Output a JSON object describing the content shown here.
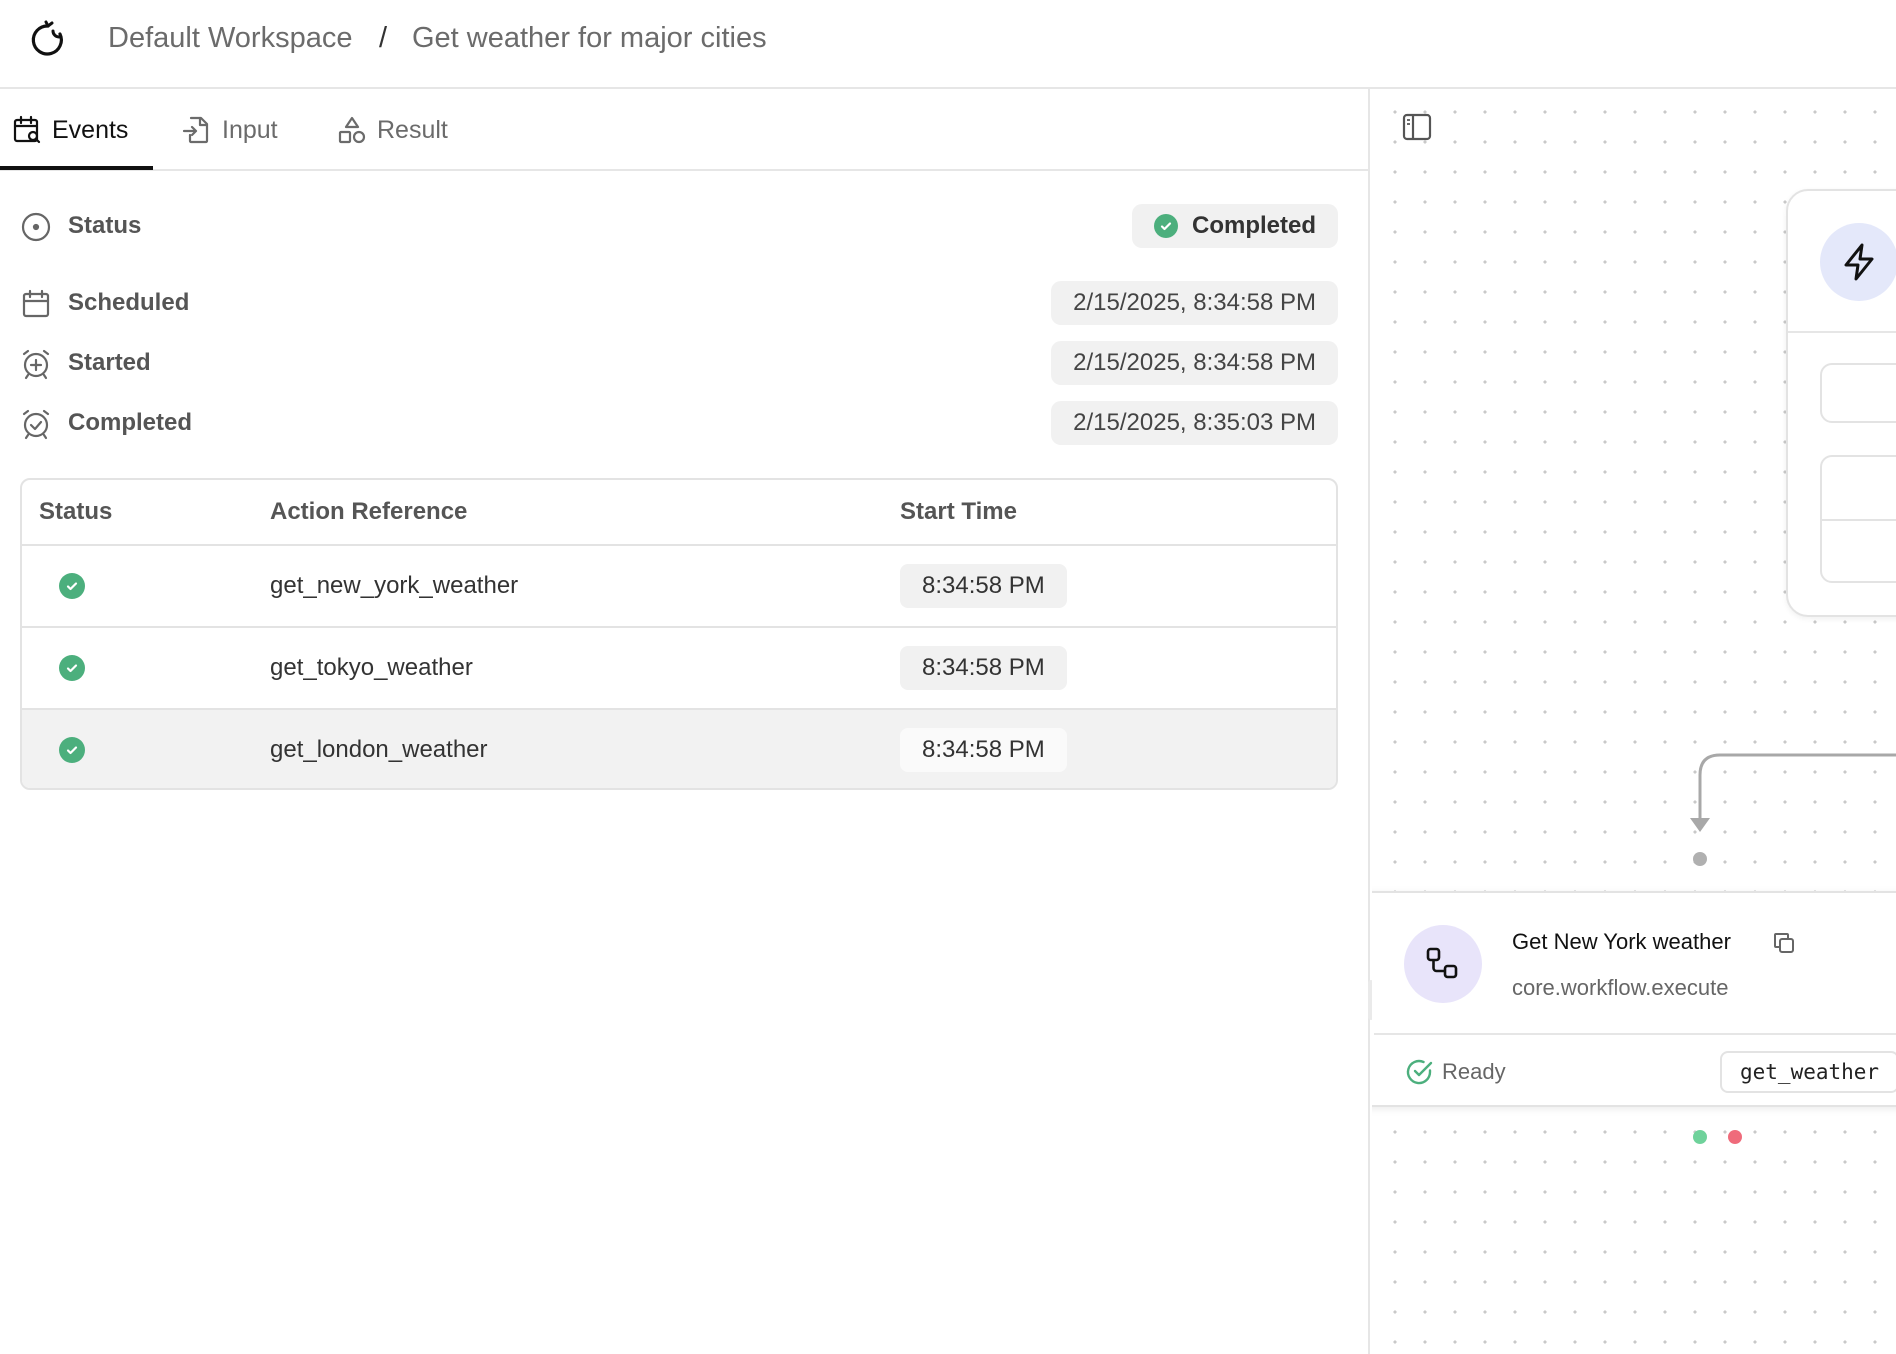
{
  "header": {
    "workspace": "Default Workspace",
    "separator": "/",
    "workflow_title": "Get weather for major cities"
  },
  "tabs": [
    {
      "label": "Events",
      "icon": "calendar-search-icon",
      "active": true
    },
    {
      "label": "Input",
      "icon": "file-import-icon",
      "active": false
    },
    {
      "label": "Result",
      "icon": "shapes-icon",
      "active": false
    }
  ],
  "meta": {
    "status": {
      "label": "Status",
      "value": "Completed",
      "icon": "circle-dot-icon"
    },
    "scheduled": {
      "label": "Scheduled",
      "value": "2/15/2025, 8:34:58 PM",
      "icon": "calendar-icon"
    },
    "started": {
      "label": "Started",
      "value": "2/15/2025, 8:34:58 PM",
      "icon": "alarm-plus-icon"
    },
    "completed": {
      "label": "Completed",
      "value": "2/15/2025, 8:35:03 PM",
      "icon": "alarm-check-icon"
    }
  },
  "events_table": {
    "columns": [
      "Status",
      "Action Reference",
      "Start Time"
    ],
    "rows": [
      {
        "status": "success",
        "ref": "get_new_york_weather",
        "start": "8:34:58 PM"
      },
      {
        "status": "success",
        "ref": "get_tokyo_weather",
        "start": "8:34:58 PM"
      },
      {
        "status": "success",
        "ref": "get_london_weather",
        "start": "8:34:58 PM"
      }
    ]
  },
  "canvas": {
    "trigger_node": {
      "icon": "lightning-icon"
    },
    "action_node": {
      "title": "Get New York weather",
      "subtitle": "core.workflow.execute",
      "status": "Ready",
      "ref": "get_weather",
      "icon": "workflow-icon"
    }
  },
  "colors": {
    "success": "#4caf7d",
    "error": "#ef6b7b",
    "edge": "#a8a8a8"
  }
}
